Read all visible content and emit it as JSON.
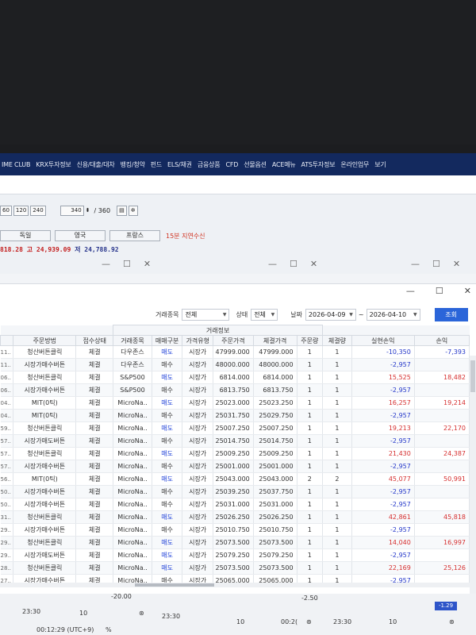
{
  "menu": [
    "IME CLUB",
    "KRX투자정보",
    "신용/대출/대차",
    "뱅킹/청약",
    "펀드",
    "ELS/채권",
    "금융상품",
    "CFD",
    "선물옵션",
    "ACE메뉴",
    "ATS투자정보",
    "온라인업무",
    "보기"
  ],
  "chart_controls": {
    "periods": [
      "60",
      "120",
      "240"
    ],
    "count": "340",
    "total": "/ 360"
  },
  "country_tabs": [
    "독일",
    "영국",
    "프랑스"
  ],
  "delay_text": "15분 지연수신",
  "index_line": {
    "prefix": "818.28",
    "high": "고 24,939.09",
    "low": "저 24,788.92"
  },
  "filter": {
    "trade_item_label": "거래종목",
    "trade_item_value": "전체",
    "status_label": "상태",
    "status_value": "전체",
    "date_label": "날짜",
    "date_from": "2026-04-09",
    "date_sep": "~",
    "date_to": "2026-04-10",
    "query_button": "조회"
  },
  "table": {
    "group_header": "거래정보",
    "columns": [
      "주문방법",
      "접수상태",
      "거래종목",
      "매매구분",
      "가격유형",
      "주문가격",
      "체결가격",
      "주문량",
      "체결량",
      "실현손익",
      "손익"
    ],
    "rows": [
      {
        "code": "11..",
        "method": "청산버튼클릭",
        "status": "체결",
        "item": "다우존스",
        "side": "매도",
        "ptype": "시장가",
        "order": "47999.000",
        "fill": "47999.000",
        "oq": "1",
        "fq": "1",
        "pnl": "-10,350",
        "pnl2": "-7,393"
      },
      {
        "code": "11..",
        "method": "시장가매수버튼",
        "status": "체결",
        "item": "다우존스",
        "side": "매수",
        "ptype": "시장가",
        "order": "48000.000",
        "fill": "48000.000",
        "oq": "1",
        "fq": "1",
        "pnl": "-2,957",
        "pnl2": ""
      },
      {
        "code": "06..",
        "method": "청산버튼클릭",
        "status": "체결",
        "item": "S&P500",
        "side": "매도",
        "ptype": "시장가",
        "order": "6814.000",
        "fill": "6814.000",
        "oq": "1",
        "fq": "1",
        "pnl": "15,525",
        "pnl2": "18,482"
      },
      {
        "code": "06..",
        "method": "시장가매수버튼",
        "status": "체결",
        "item": "S&P500",
        "side": "매수",
        "ptype": "시장가",
        "order": "6813.750",
        "fill": "6813.750",
        "oq": "1",
        "fq": "1",
        "pnl": "-2,957",
        "pnl2": ""
      },
      {
        "code": "04..",
        "method": "MIT(0틱)",
        "status": "체결",
        "item": "MicroNa..",
        "side": "매도",
        "ptype": "시장가",
        "order": "25023.000",
        "fill": "25023.250",
        "oq": "1",
        "fq": "1",
        "pnl": "16,257",
        "pnl2": "19,214"
      },
      {
        "code": "04..",
        "method": "MIT(0틱)",
        "status": "체결",
        "item": "MicroNa..",
        "side": "매수",
        "ptype": "시장가",
        "order": "25031.750",
        "fill": "25029.750",
        "oq": "1",
        "fq": "1",
        "pnl": "-2,957",
        "pnl2": ""
      },
      {
        "code": "59..",
        "method": "청산버튼클릭",
        "status": "체결",
        "item": "MicroNa..",
        "side": "매도",
        "ptype": "시장가",
        "order": "25007.250",
        "fill": "25007.250",
        "oq": "1",
        "fq": "1",
        "pnl": "19,213",
        "pnl2": "22,170"
      },
      {
        "code": "57..",
        "method": "시장가매도버튼",
        "status": "체결",
        "item": "MicroNa..",
        "side": "매수",
        "ptype": "시장가",
        "order": "25014.750",
        "fill": "25014.750",
        "oq": "1",
        "fq": "1",
        "pnl": "-2,957",
        "pnl2": ""
      },
      {
        "code": "57..",
        "method": "청산버튼클릭",
        "status": "체결",
        "item": "MicroNa..",
        "side": "매도",
        "ptype": "시장가",
        "order": "25009.250",
        "fill": "25009.250",
        "oq": "1",
        "fq": "1",
        "pnl": "21,430",
        "pnl2": "24,387"
      },
      {
        "code": "57..",
        "method": "시장가매수버튼",
        "status": "체결",
        "item": "MicroNa..",
        "side": "매수",
        "ptype": "시장가",
        "order": "25001.000",
        "fill": "25001.000",
        "oq": "1",
        "fq": "1",
        "pnl": "-2,957",
        "pnl2": ""
      },
      {
        "code": "56..",
        "method": "MIT(0틱)",
        "status": "체결",
        "item": "MicroNa..",
        "side": "매도",
        "ptype": "시장가",
        "order": "25043.000",
        "fill": "25043.000",
        "oq": "2",
        "fq": "2",
        "pnl": "45,077",
        "pnl2": "50,991"
      },
      {
        "code": "50..",
        "method": "시장가매수버튼",
        "status": "체결",
        "item": "MicroNa..",
        "side": "매수",
        "ptype": "시장가",
        "order": "25039.250",
        "fill": "25037.750",
        "oq": "1",
        "fq": "1",
        "pnl": "-2,957",
        "pnl2": ""
      },
      {
        "code": "50..",
        "method": "시장가매수버튼",
        "status": "체결",
        "item": "MicroNa..",
        "side": "매수",
        "ptype": "시장가",
        "order": "25031.000",
        "fill": "25031.000",
        "oq": "1",
        "fq": "1",
        "pnl": "-2,957",
        "pnl2": ""
      },
      {
        "code": "31..",
        "method": "청산버튼클릭",
        "status": "체결",
        "item": "MicroNa..",
        "side": "매도",
        "ptype": "시장가",
        "order": "25026.250",
        "fill": "25026.250",
        "oq": "1",
        "fq": "1",
        "pnl": "42,861",
        "pnl2": "45,818"
      },
      {
        "code": "29..",
        "method": "시장가매수버튼",
        "status": "체결",
        "item": "MicroNa..",
        "side": "매수",
        "ptype": "시장가",
        "order": "25010.750",
        "fill": "25010.750",
        "oq": "1",
        "fq": "1",
        "pnl": "-2,957",
        "pnl2": ""
      },
      {
        "code": "29..",
        "method": "청산버튼클릭",
        "status": "체결",
        "item": "MicroNa..",
        "side": "매도",
        "ptype": "시장가",
        "order": "25073.500",
        "fill": "25073.500",
        "oq": "1",
        "fq": "1",
        "pnl": "14,040",
        "pnl2": "16,997"
      },
      {
        "code": "29..",
        "method": "시장가매도버튼",
        "status": "체결",
        "item": "MicroNa..",
        "side": "매도",
        "ptype": "시장가",
        "order": "25079.250",
        "fill": "25079.250",
        "oq": "1",
        "fq": "1",
        "pnl": "-2,957",
        "pnl2": ""
      },
      {
        "code": "28..",
        "method": "청산버튼클릭",
        "status": "체결",
        "item": "MicroNa..",
        "side": "매도",
        "ptype": "시장가",
        "order": "25073.500",
        "fill": "25073.500",
        "oq": "1",
        "fq": "1",
        "pnl": "22,169",
        "pnl2": "25,126"
      },
      {
        "code": "27..",
        "method": "시장가매수버튼",
        "status": "체결",
        "item": "MicroNa..",
        "side": "매수",
        "ptype": "시장가",
        "order": "25065.000",
        "fill": "25065.000",
        "oq": "1",
        "fq": "1",
        "pnl": "-2,957",
        "pnl2": ""
      }
    ]
  },
  "bottom": {
    "left_value": "-20.00",
    "time1": "23:30",
    "ten1": "10",
    "time2": "23:30",
    "ten2": "10",
    "clip": "00:2(",
    "time3": "23:30",
    "ten3": "10",
    "right_value": "-2.50",
    "badge": "-1.29",
    "clock": "00:12:29 (UTC+9)",
    "pct": "%"
  }
}
